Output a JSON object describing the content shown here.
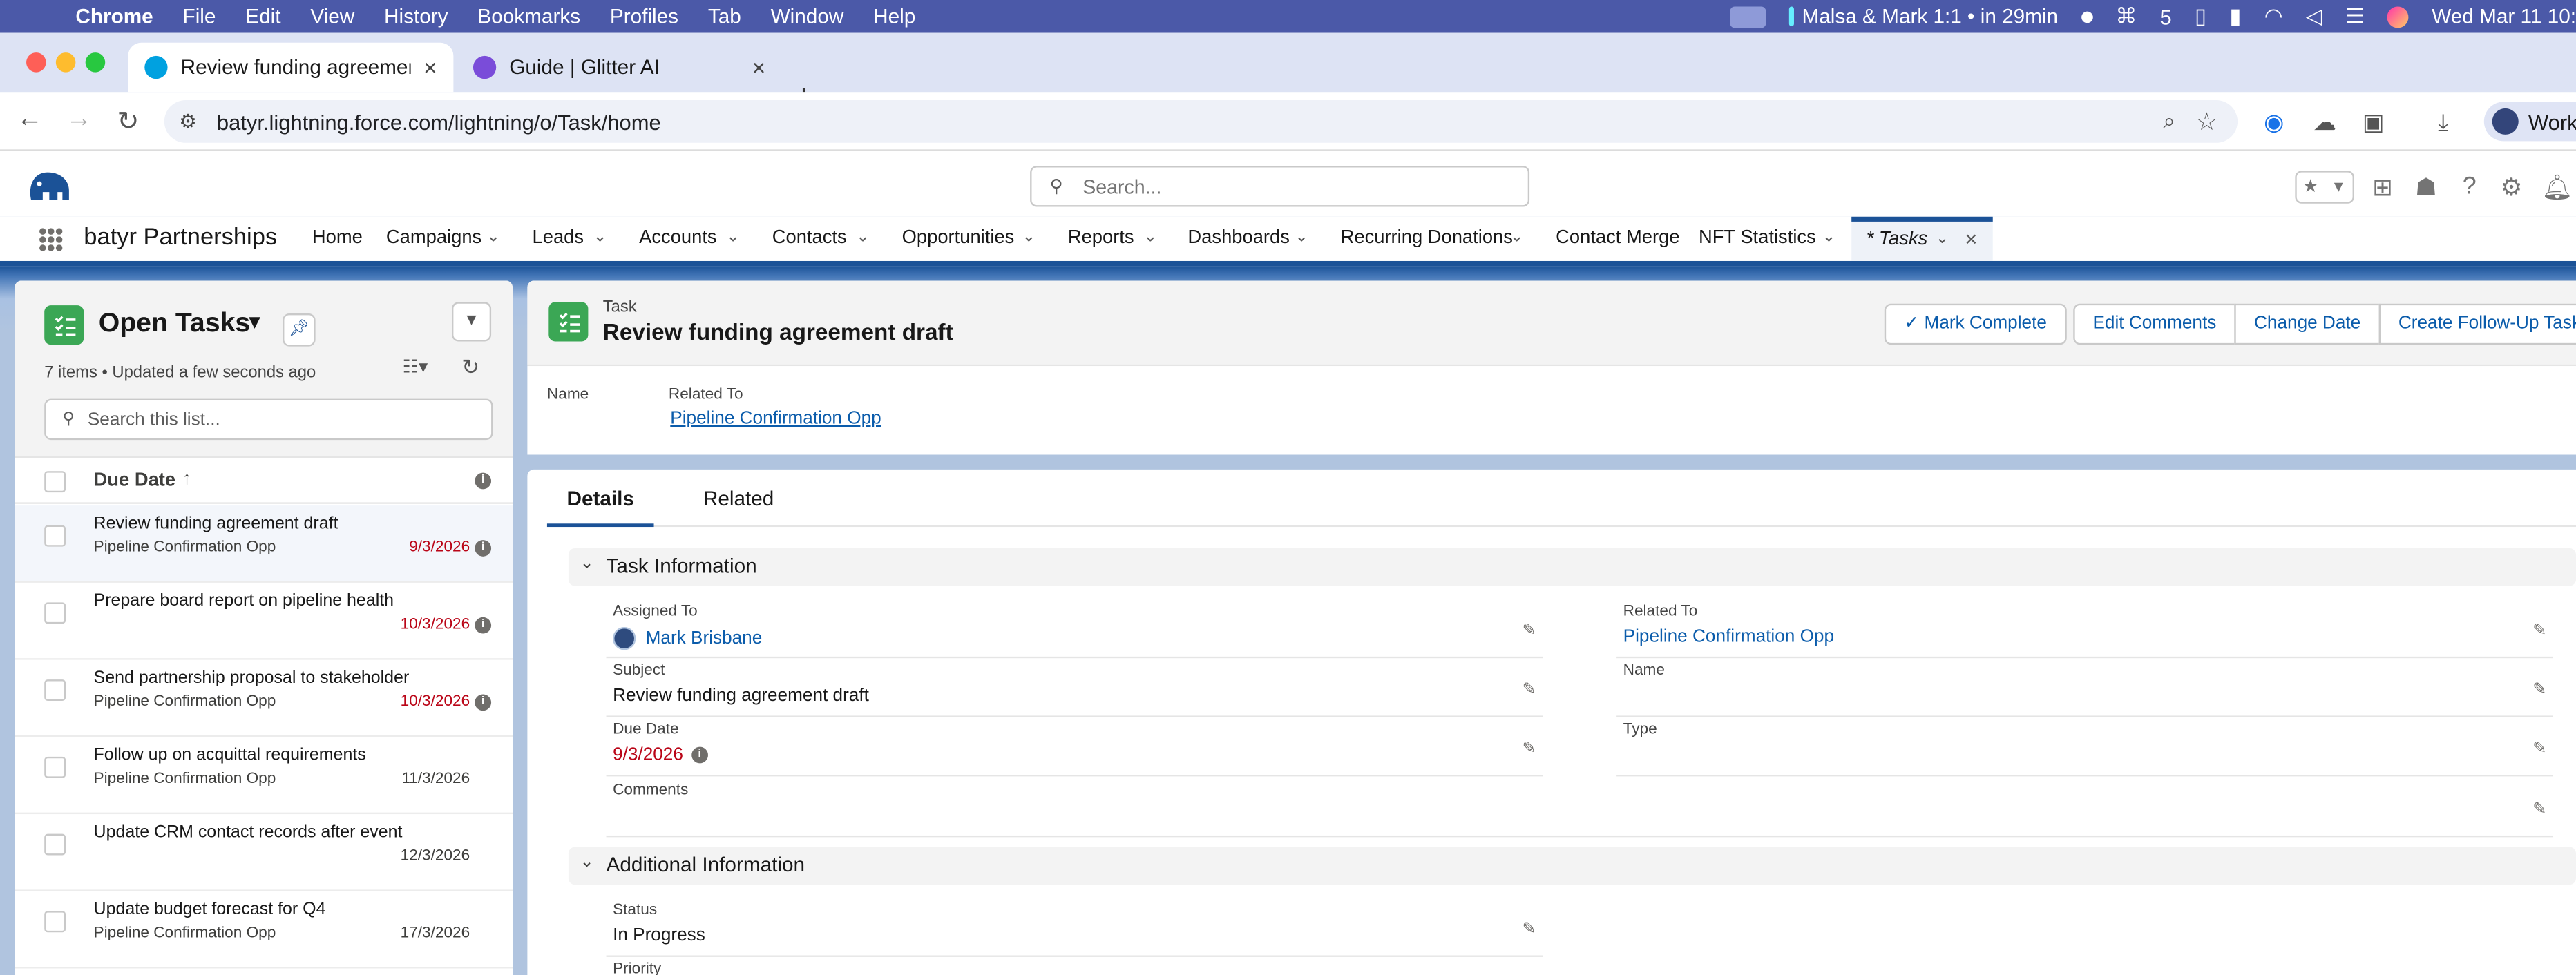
{
  "menubar": {
    "app": "Chrome",
    "menus": [
      "File",
      "Edit",
      "View",
      "History",
      "Bookmarks",
      "Profiles",
      "Tab",
      "Window",
      "Help"
    ],
    "event": "Malsa & Mark 1:1 • in 29min",
    "badge_count": "5",
    "clock": "Wed Mar 11 10:"
  },
  "browser": {
    "tabs": [
      {
        "title": "Review funding agreement dr",
        "active": true
      },
      {
        "title": "Guide | Glitter AI",
        "active": false
      }
    ],
    "url": "batyr.lightning.force.com/lightning/o/Task/home",
    "profile_label": "Work"
  },
  "sf": {
    "search_placeholder": "Search...",
    "app_name": "batyr Partnerships",
    "nav": [
      {
        "label": "Home",
        "dropdown": false
      },
      {
        "label": "Campaigns",
        "dropdown": true
      },
      {
        "label": "Leads",
        "dropdown": true
      },
      {
        "label": "Accounts",
        "dropdown": true
      },
      {
        "label": "Contacts",
        "dropdown": true
      },
      {
        "label": "Opportunities",
        "dropdown": true
      },
      {
        "label": "Reports",
        "dropdown": true
      },
      {
        "label": "Dashboards",
        "dropdown": true
      },
      {
        "label": "Recurring Donations",
        "dropdown": true
      },
      {
        "label": "Contact Merge",
        "dropdown": false
      },
      {
        "label": "NFT Statistics",
        "dropdown": true
      }
    ],
    "active_tab": "* Tasks"
  },
  "list": {
    "title": "Open Tasks",
    "meta": "7 items • Updated a few seconds ago",
    "search_placeholder": "Search this list...",
    "column": "Due Date",
    "rows": [
      {
        "subject": "Review funding agreement draft",
        "related": "Pipeline Confirmation Opp",
        "due": "9/3/2026",
        "overdue": true
      },
      {
        "subject": "Prepare board report on pipeline health",
        "related": "",
        "due": "10/3/2026",
        "overdue": true
      },
      {
        "subject": "Send partnership proposal to stakeholder",
        "related": "Pipeline Confirmation Opp",
        "due": "10/3/2026",
        "overdue": true
      },
      {
        "subject": "Follow up on acquittal requirements",
        "related": "Pipeline Confirmation Opp",
        "due": "11/3/2026",
        "overdue": false
      },
      {
        "subject": "Update CRM contact records after event",
        "related": "",
        "due": "12/3/2026",
        "overdue": false
      },
      {
        "subject": "Update budget forecast for Q4",
        "related": "Pipeline Confirmation Opp",
        "due": "17/3/2026",
        "overdue": false
      }
    ]
  },
  "record": {
    "type": "Task",
    "title": "Review funding agreement draft",
    "buttons": {
      "mark_complete": "Mark Complete",
      "edit_comments": "Edit Comments",
      "change_date": "Change Date",
      "follow_up": "Create Follow-Up Task"
    },
    "highlights": {
      "name_label": "Name",
      "related_label": "Related To",
      "related_value": "Pipeline Confirmation Opp"
    },
    "tabs": {
      "details": "Details",
      "related": "Related"
    },
    "sections": {
      "task_info": "Task Information",
      "additional_info": "Additional Information"
    },
    "fields": {
      "assigned_to_label": "Assigned To",
      "assigned_to_value": "Mark Brisbane",
      "related_to_label": "Related To",
      "related_to_value": "Pipeline Confirmation Opp",
      "subject_label": "Subject",
      "subject_value": "Review funding agreement draft",
      "name_label": "Name",
      "due_date_label": "Due Date",
      "due_date_value": "9/3/2026",
      "type_label": "Type",
      "comments_label": "Comments",
      "status_label": "Status",
      "status_value": "In Progress",
      "priority_label": "Priority"
    }
  },
  "colors": {
    "menubar": "#4b59a8",
    "brand_blue": "#1b5297",
    "link": "#0b5cab",
    "overdue": "#ba0517",
    "task_green": "#3ba755"
  }
}
